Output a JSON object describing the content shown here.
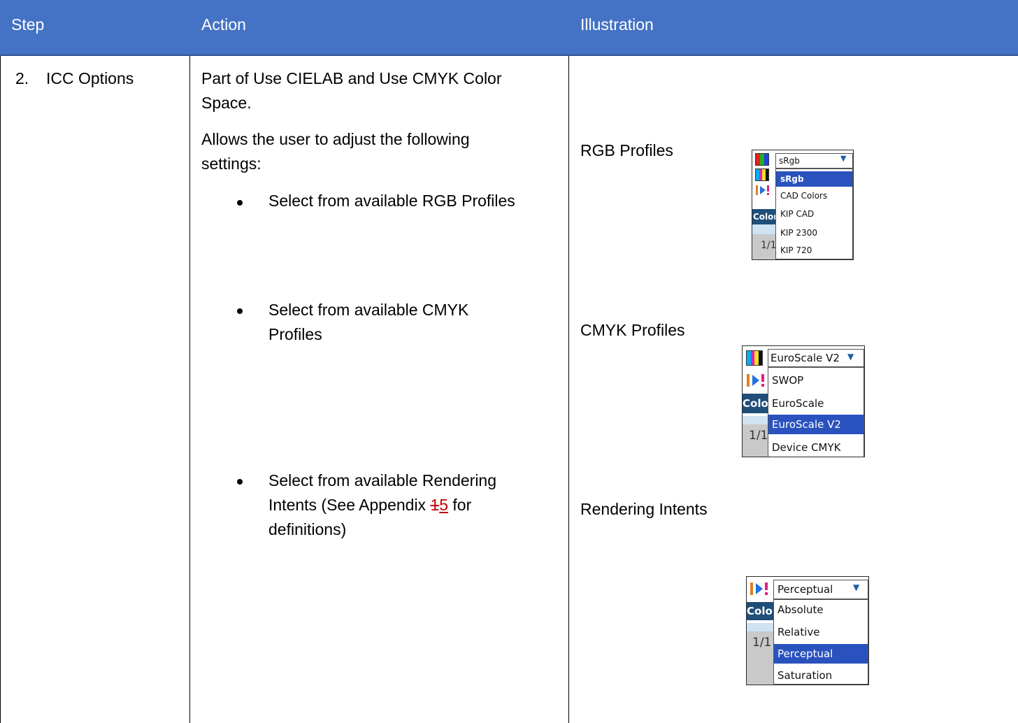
{
  "header": {
    "step": "Step",
    "action": "Action",
    "illustration": "Illustration"
  },
  "row": {
    "step_number": "2.",
    "step_label": "ICC Options",
    "intro_line1": "Part of Use CIELAB and Use CMYK Color",
    "intro_line2": "Space.",
    "allows_line1": "Allows the user to adjust the following",
    "allows_line2": "settings:",
    "bullet1": "Select from available RGB Profiles",
    "bullet2_line1": "Select from available CMYK",
    "bullet2_line2": "Profiles",
    "bullet3_line1": "Select from available Rendering",
    "bullet3_line2_pre": "Intents (See Appendix ",
    "bullet3_deleted": "1",
    "bullet3_inserted": "5",
    "bullet3_line2_post": " for",
    "bullet3_line3": "definitions)"
  },
  "illustrations": {
    "rgb_label": "RGB Profiles",
    "cmyk_label": "CMYK Profiles",
    "intent_label": "Rendering Intents"
  },
  "rgb_dropdown": {
    "selected": "sRgb",
    "options": [
      "sRgb",
      "CAD Colors",
      "KIP CAD",
      "KIP 2300",
      "KIP 720"
    ],
    "highlighted": "sRgb",
    "side_label": "Color",
    "page_fragment": "1/1"
  },
  "cmyk_dropdown": {
    "selected": "EuroScale V2",
    "options": [
      "SWOP",
      "EuroScale",
      "EuroScale V2",
      "Device CMYK"
    ],
    "highlighted": "EuroScale V2",
    "side_label": "Color",
    "page_fragment": "1/1"
  },
  "intent_dropdown": {
    "selected": "Perceptual",
    "options": [
      "Absolute",
      "Relative",
      "Perceptual",
      "Saturation"
    ],
    "highlighted": "Perceptual",
    "side_label": "Color",
    "page_fragment": "1/1"
  },
  "colors": {
    "header_bg": "#4472c4",
    "header_text": "#ffffff",
    "highlight": "#2a52be",
    "revision_mark": "#c00000",
    "chevron": "#1f5fa8"
  },
  "icons": [
    "rgb-bars-icon",
    "cmyk-bars-icon",
    "intent-play-icon",
    "chevron-down-icon",
    "bullet-icon"
  ]
}
